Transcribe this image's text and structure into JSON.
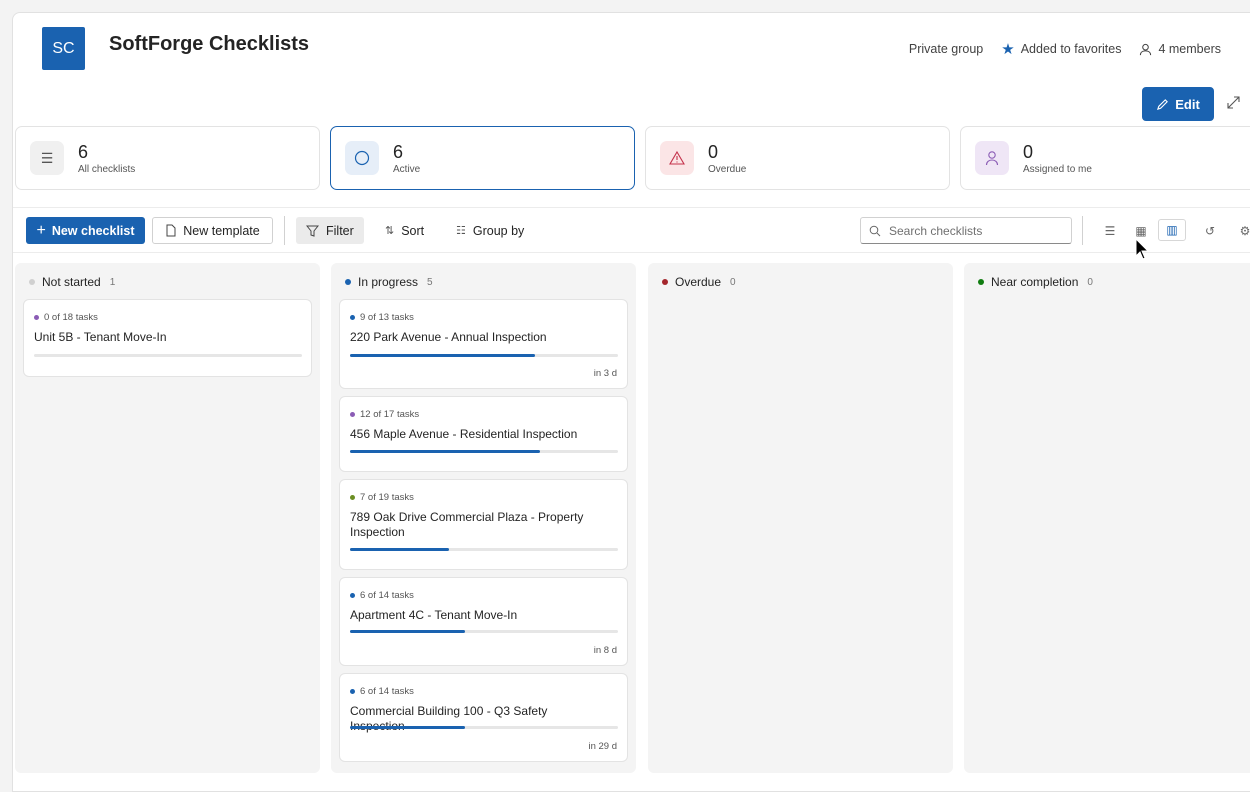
{
  "header": {
    "avatar_initials": "SC",
    "title": "SoftForge Checklists",
    "privacy": "Private group",
    "favorite": "Added to favorites",
    "members": "4 members",
    "edit_label": "Edit"
  },
  "stats": [
    {
      "value": "6",
      "label": "All checklists",
      "icon": "checklist-icon"
    },
    {
      "value": "6",
      "label": "Active",
      "icon": "circle-icon"
    },
    {
      "value": "0",
      "label": "Overdue",
      "icon": "warning-icon"
    },
    {
      "value": "0",
      "label": "Assigned to me",
      "icon": "person-icon"
    }
  ],
  "toolbar": {
    "new_checklist": "New checklist",
    "new_template": "New template",
    "filter": "Filter",
    "sort": "Sort",
    "group_by": "Group by",
    "search_placeholder": "Search checklists"
  },
  "columns": [
    {
      "name": "Not started",
      "count": "1",
      "color": "#d0d0d0"
    },
    {
      "name": "In progress",
      "count": "5",
      "color": "#1a62b0"
    },
    {
      "name": "Overdue",
      "count": "0",
      "color": "#a4262c"
    },
    {
      "name": "Near completion",
      "count": "0",
      "color": "#107c10"
    }
  ],
  "cards": [
    {
      "tasks": "0 of 18 tasks",
      "name": "Unit 5B - Tenant Move-In",
      "progress": 0,
      "dot": "#8b5cb5",
      "due": ""
    },
    {
      "tasks": "9 of 13 tasks",
      "name": "220 Park Avenue - Annual Inspection",
      "progress": 0.69,
      "dot": "#1a62b0",
      "due": "in 3 d"
    },
    {
      "tasks": "12 of 17 tasks",
      "name": "456 Maple Avenue - Residential Inspection",
      "progress": 0.71,
      "dot": "#8b5cb5",
      "due": ""
    },
    {
      "tasks": "7 of 19 tasks",
      "name": "789 Oak Drive Commercial Plaza - Property Inspection",
      "progress": 0.37,
      "dot": "#6b8e23",
      "due": ""
    },
    {
      "tasks": "6 of 14 tasks",
      "name": "Apartment 4C - Tenant Move-In",
      "progress": 0.43,
      "dot": "#1a62b0",
      "due": "in 8 d"
    },
    {
      "tasks": "6 of 14 tasks",
      "name": "Commercial Building 100 - Q3 Safety Inspection",
      "progress": 0.43,
      "dot": "#1a62b0",
      "due": "in 29 d"
    }
  ]
}
